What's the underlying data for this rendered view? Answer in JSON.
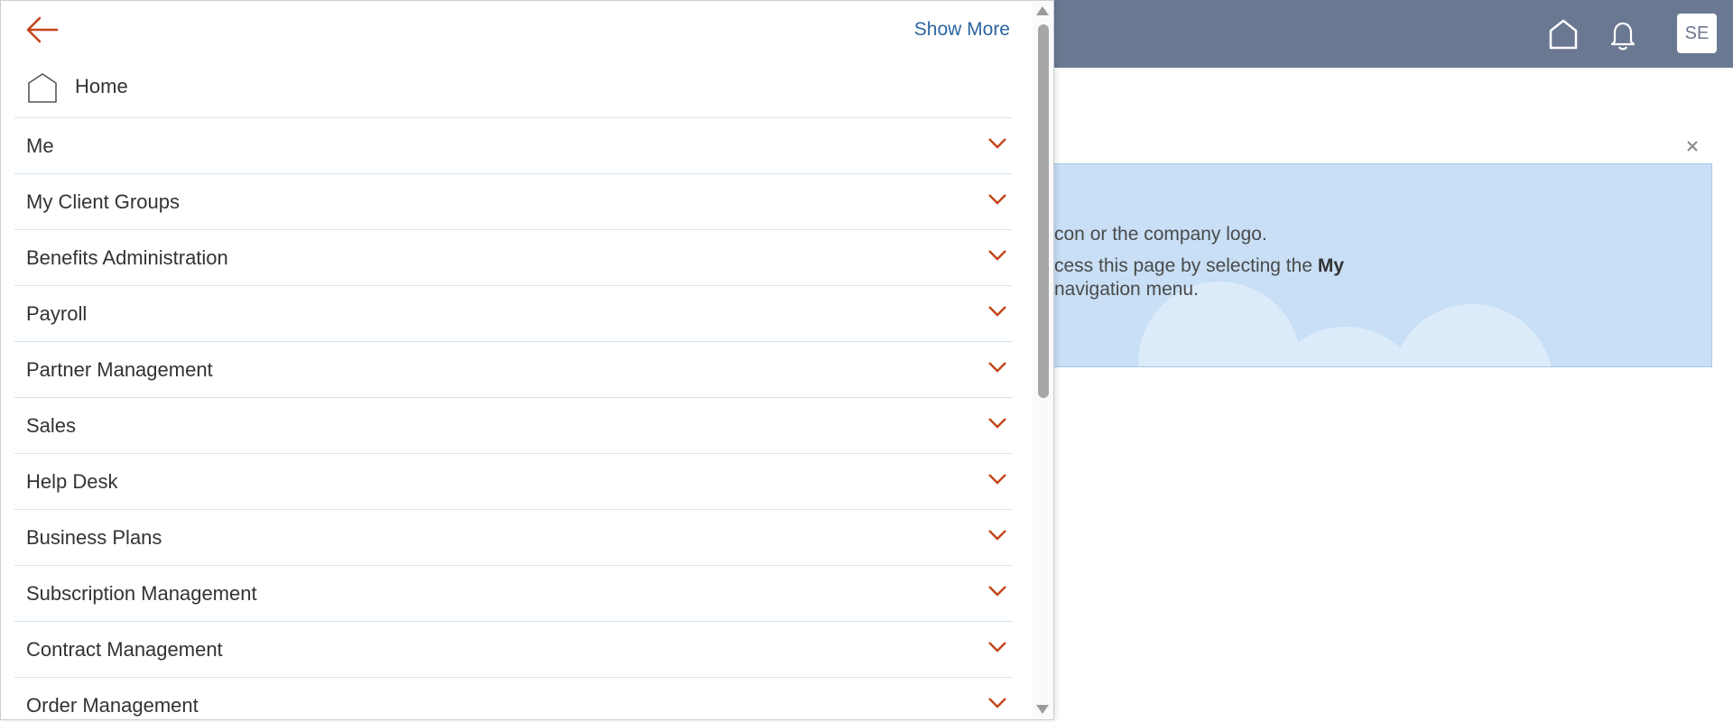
{
  "header": {
    "avatar_initials": "SE"
  },
  "banner": {
    "line1": "con or the company logo.",
    "line2_prefix": "cess this page by selecting the ",
    "line2_bold": "My",
    "line3": "navigation menu."
  },
  "drawer": {
    "show_more_label": "Show More",
    "home_label": "Home",
    "items": [
      {
        "label": "Me"
      },
      {
        "label": "My Client Groups"
      },
      {
        "label": "Benefits Administration"
      },
      {
        "label": "Payroll"
      },
      {
        "label": "Partner Management"
      },
      {
        "label": "Sales"
      },
      {
        "label": "Help Desk"
      },
      {
        "label": "Business Plans"
      },
      {
        "label": "Subscription Management"
      },
      {
        "label": "Contract Management"
      },
      {
        "label": "Order Management"
      }
    ]
  },
  "colors": {
    "header_bg": "#6b7891",
    "accent_orange": "#c4441a",
    "link_blue": "#2b65a0",
    "banner_bg": "#c8dff5"
  },
  "icons": {
    "back": "arrow-left-icon",
    "home": "home-icon",
    "bell": "bell-icon",
    "close": "close-icon",
    "chevron": "chevron-down-icon"
  }
}
